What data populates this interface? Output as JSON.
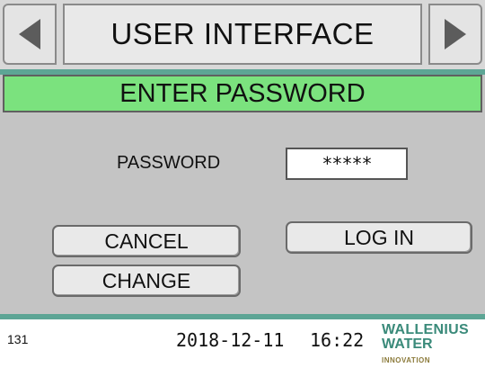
{
  "header": {
    "title": "USER INTERFACE",
    "prev_icon": "triangle-left-icon",
    "next_icon": "triangle-right-icon"
  },
  "section": {
    "title": "ENTER PASSWORD"
  },
  "form": {
    "password_label": "PASSWORD",
    "password_value": "*****"
  },
  "buttons": {
    "cancel": "CANCEL",
    "login": "LOG IN",
    "change": "CHANGE"
  },
  "footer": {
    "screen_number": "131",
    "date": "2018-12-11",
    "time": "16:22",
    "logo_line1": "WALLENIUS",
    "logo_line2": "WATER",
    "logo_line2_suffix": "INNOVATION"
  },
  "colors": {
    "accent_green": "#7be27e",
    "teal": "#5da595",
    "panel_gray": "#c4c4c4"
  }
}
